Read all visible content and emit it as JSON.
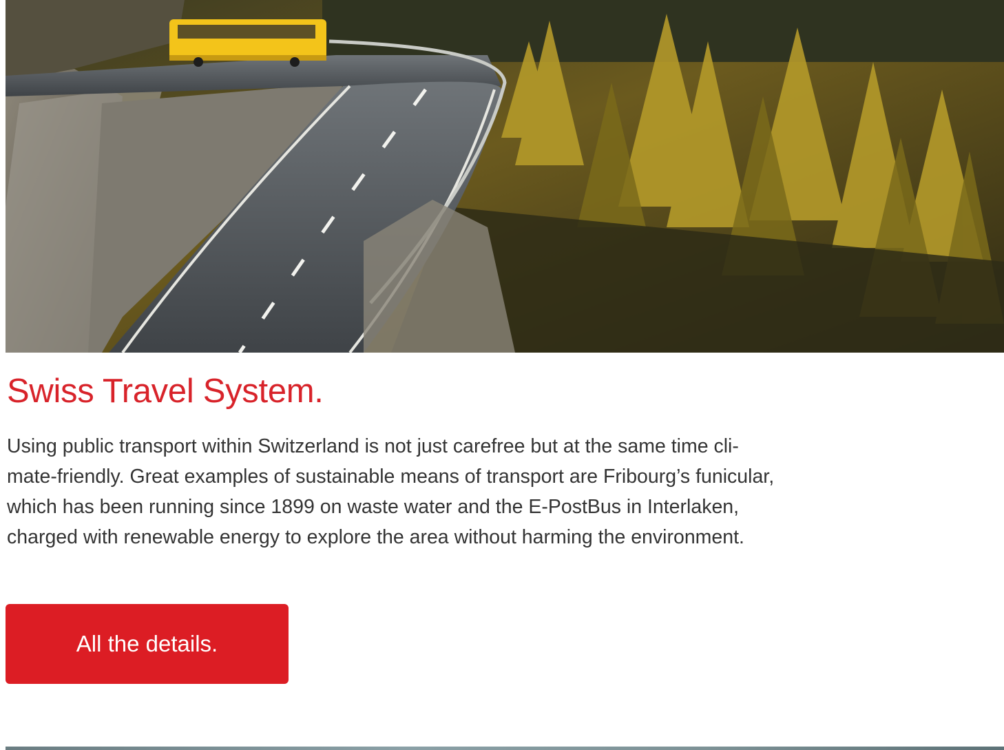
{
  "hero": {
    "image_description": "",
    "image_alt": "Yellow PostBus on a winding mountain road through an autumn larch forest"
  },
  "article": {
    "title": "Swiss Travel System.",
    "body_lines": [
      "Using public transport within Switzerland is not just carefree but at the same time cli-",
      "mate-friendly. Great examples of sustainable means of transport are Fribourg’s funicular,",
      "which has been running since 1899 on waste water and the E-PostBus in Interlaken,",
      "charged with renewable energy to explore the area without harming the environment."
    ],
    "cta_label": "All the details."
  },
  "colors": {
    "accent": "#dc1d24",
    "title": "#d8232a",
    "text": "#333333"
  }
}
